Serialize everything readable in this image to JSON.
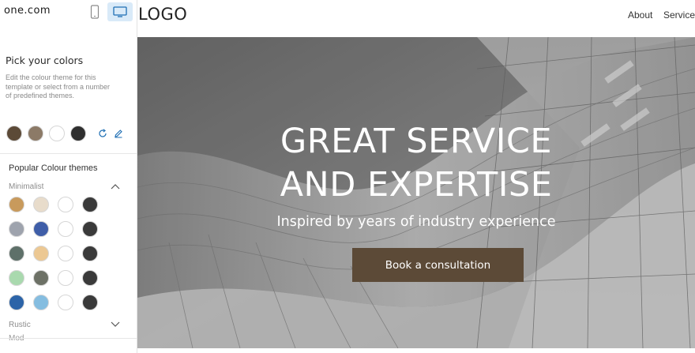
{
  "brand": "one.com",
  "toolbar": {
    "mobile_icon": "mobile-phone-icon",
    "desktop_icon": "desktop-monitor-icon",
    "active_color": "#d9eaf8",
    "icon_color": "#1f6fb4"
  },
  "sidebar": {
    "title": "Pick your colors",
    "description": "Edit the colour theme for this template or select from a number of predefined themes.",
    "current_colors": [
      "#5c4a37",
      "#8c7a67",
      "#ffffff",
      "#2f2f2f"
    ],
    "reset_icon": "refresh-icon",
    "edit_icon": "pencil-icon",
    "popular_title": "Popular Colour themes",
    "groups": [
      {
        "name": "Minimalist",
        "expanded": true,
        "icon": "chevron-up-icon",
        "themes": [
          [
            "#c89a5c",
            "#e8dccb",
            "#ffffff",
            "#3a3a3a"
          ],
          [
            "#9ea3ad",
            "#3f5ea8",
            "#ffffff",
            "#3a3a3a"
          ],
          [
            "#5e7069",
            "#ecc893",
            "#ffffff",
            "#3a3a3a"
          ],
          [
            "#a9d9ae",
            "#6d7166",
            "#ffffff",
            "#3a3a3a"
          ],
          [
            "#2c64a8",
            "#85bde0",
            "#ffffff",
            "#3a3a3a"
          ]
        ]
      },
      {
        "name": "Rustic",
        "expanded": false,
        "icon": "chevron-down-icon"
      }
    ],
    "next_group_partial": "Mod"
  },
  "preview": {
    "logo": "LOGO",
    "nav": [
      "About",
      "Services"
    ],
    "hero": {
      "title_line1": "GREAT SERVICE",
      "title_line2": "AND EXPERTISE",
      "subtitle": "Inspired by years of industry experience",
      "cta_label": "Book a consultation",
      "cta_color": "#5c4a37",
      "background": "architecture-photo-grayscale"
    }
  }
}
